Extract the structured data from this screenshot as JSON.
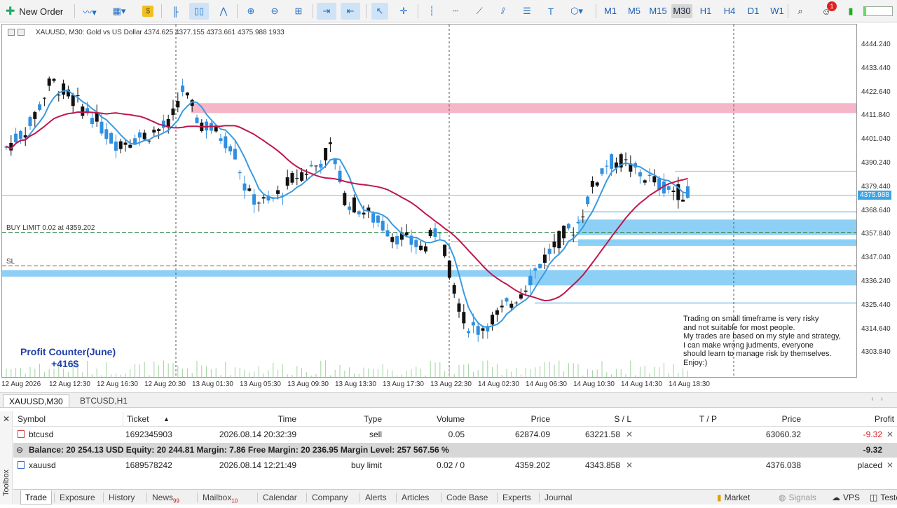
{
  "toolbar": {
    "new_order_label": "New Order",
    "timeframes": [
      "M1",
      "M5",
      "M15",
      "M30",
      "H1",
      "H4",
      "D1",
      "W1"
    ],
    "active_timeframe": "M30",
    "notification_count": "1"
  },
  "chart": {
    "header": "XAUUSD, M30:  Gold vs US Dollar  4374.625 4377.155 4373.661 4375.988  1933",
    "buy_limit_label": "BUY LIMIT 0.02 at 4359.202",
    "sl_label": "SL",
    "profit_counter_title": "Profit Counter(June)",
    "profit_counter_value": "+416$",
    "disclaimer_lines": [
      "Trading on small timeframe is very risky",
      "and not suitable for most people.",
      "My trades are based on my style and strategy,",
      "I can make wrong judments, everyone",
      "should learn to manage risk by themselves.",
      "Enjoy:)"
    ],
    "current_price": "4375.988",
    "price_labels": [
      "4444.240",
      "4433.440",
      "4422.640",
      "4411.840",
      "4401.040",
      "4390.240",
      "4379.440",
      "4368.640",
      "4357.840",
      "4347.040",
      "4336.240",
      "4325.440",
      "4314.640",
      "4303.840"
    ],
    "time_labels": [
      "12 Aug 2026",
      "12 Aug 12:30",
      "12 Aug 16:30",
      "12 Aug 20:30",
      "13 Aug 01:30",
      "13 Aug 05:30",
      "13 Aug 09:30",
      "13 Aug 13:30",
      "13 Aug 17:30",
      "13 Aug 22:30",
      "14 Aug 02:30",
      "14 Aug 06:30",
      "14 Aug 10:30",
      "14 Aug 14:30",
      "14 Aug 18:30"
    ],
    "colors": {
      "bull": "#2f8fe0",
      "bear": "#111111",
      "ma_fast": "#3a9ae0",
      "ma_slow": "#c0174a",
      "zone_red": "#f4b6c8",
      "zone_blue": "#8ed0f5"
    }
  },
  "chart_tabs": [
    "XAUUSD,M30",
    "BTCUSD,H1"
  ],
  "trade_table": {
    "headers": {
      "symbol": "Symbol",
      "ticket": "Ticket",
      "time": "Time",
      "type": "Type",
      "volume": "Volume",
      "price": "Price",
      "sl": "S / L",
      "tp": "T / P",
      "cur_price": "Price",
      "profit": "Profit"
    },
    "rows": [
      {
        "symbol": "btcusd",
        "ticket": "1692345903",
        "time": "2026.08.14 20:32:39",
        "type": "sell",
        "volume": "0.05",
        "price": "62874.09",
        "sl": "63221.58",
        "tp": "",
        "cur_price": "63060.32",
        "profit": "-9.32"
      },
      {
        "symbol": "xauusd",
        "ticket": "1689578242",
        "time": "2026.08.14 12:21:49",
        "type": "buy limit",
        "volume": "0.02 / 0",
        "price": "4359.202",
        "sl": "4343.858",
        "tp": "",
        "cur_price": "4376.038",
        "profit": "placed"
      }
    ],
    "balance_line": "Balance: 20 254.13 USD  Equity: 20 244.81  Margin: 7.86  Free Margin: 20 236.95  Margin Level: 257 567.56 %",
    "balance_profit": "-9.32"
  },
  "toolbox_label": "Toolbox",
  "bottom_tabs": [
    {
      "label": "Trade",
      "badge": ""
    },
    {
      "label": "Exposure",
      "badge": ""
    },
    {
      "label": "History",
      "badge": ""
    },
    {
      "label": "News",
      "badge": "99"
    },
    {
      "label": "Mailbox",
      "badge": "10"
    },
    {
      "label": "Calendar",
      "badge": ""
    },
    {
      "label": "Company",
      "badge": ""
    },
    {
      "label": "Alerts",
      "badge": ""
    },
    {
      "label": "Articles",
      "badge": ""
    },
    {
      "label": "Code Base",
      "badge": ""
    },
    {
      "label": "Experts",
      "badge": ""
    },
    {
      "label": "Journal",
      "badge": ""
    }
  ],
  "bottom_right": {
    "market": "Market",
    "signals": "Signals",
    "vps": "VPS",
    "tester": "Tester"
  }
}
